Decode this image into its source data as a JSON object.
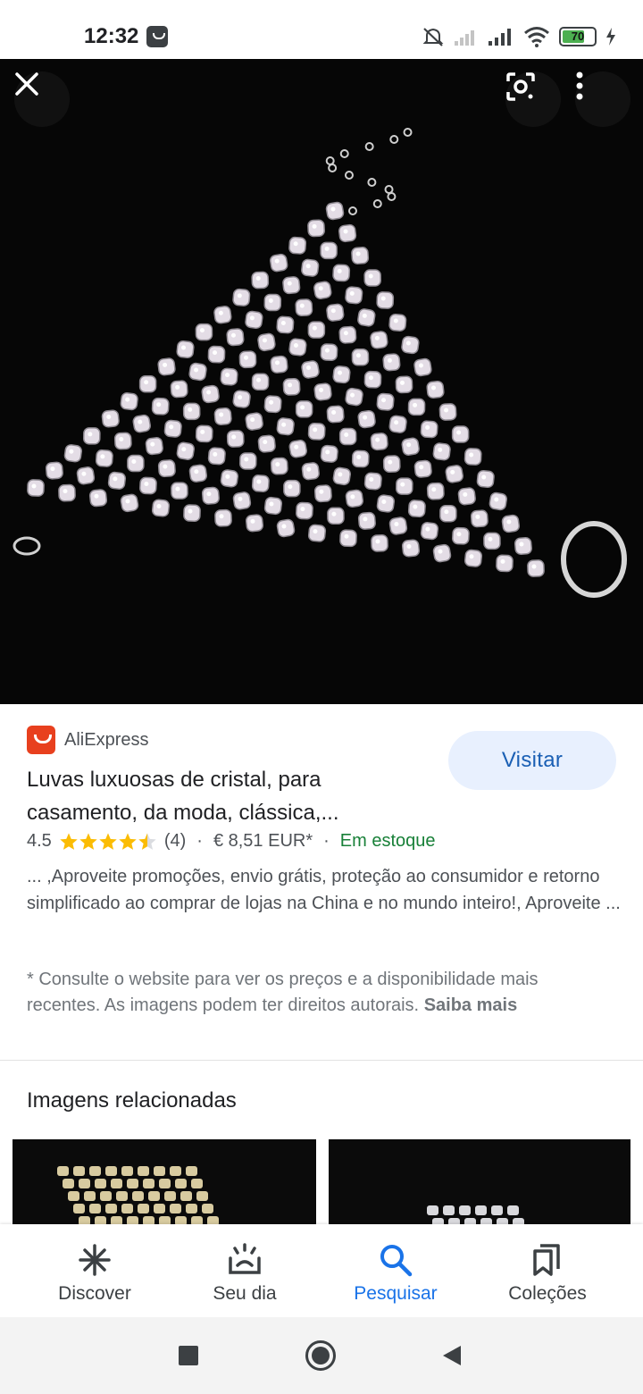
{
  "status_bar": {
    "time": "12:32",
    "battery": "70"
  },
  "icons": {
    "close": "close-icon",
    "lens": "google-lens-icon",
    "more": "more-vertical-icon"
  },
  "result": {
    "source": "AliExpress",
    "visit_label": "Visitar",
    "title": "Luvas luxuosas de cristal, para casamento, da moda, clássica,...",
    "rating": "4.5",
    "rating_value": 4.5,
    "review_count": "(4)",
    "price": "€ 8,51 EUR*",
    "availability": "Em estoque",
    "description": "... ,Aproveite promoções, envio grátis, proteção ao consumidor e retorno simplificado ao comprar de lojas na China e no mundo inteiro!, Aproveite ...",
    "disclaimer": "* Consulte o website para ver os preços e a disponibilidade mais recentes. As imagens podem ter direitos autorais.",
    "learn_more": "Saiba mais"
  },
  "related": {
    "title": "Imagens relacionadas"
  },
  "bottom_nav": {
    "items": [
      {
        "label": "Discover",
        "icon": "asterisk-icon"
      },
      {
        "label": "Seu dia",
        "icon": "sunrise-icon"
      },
      {
        "label": "Pesquisar",
        "icon": "search-icon"
      },
      {
        "label": "Coleções",
        "icon": "bookmarks-icon"
      }
    ]
  },
  "colors": {
    "accent": "#1a73e8",
    "stock": "#188038",
    "star": "#fbbc04",
    "visit_bg": "#e8f0fe"
  }
}
